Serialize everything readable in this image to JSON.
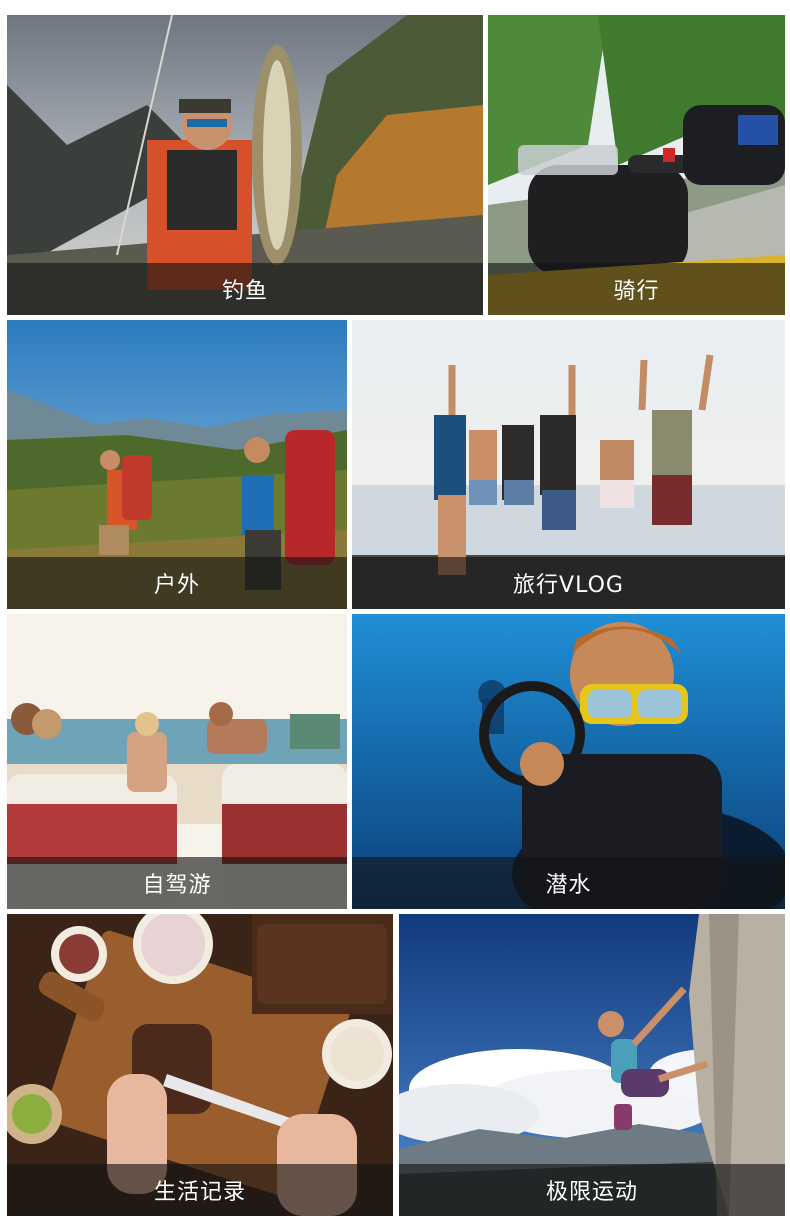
{
  "tiles": [
    {
      "label": "钓鱼"
    },
    {
      "label": "骑行"
    },
    {
      "label": "户外"
    },
    {
      "label": "旅行VLOG"
    },
    {
      "label": "自驾游"
    },
    {
      "label": "潜水"
    },
    {
      "label": "生活记录"
    },
    {
      "label": "极限运动"
    }
  ]
}
